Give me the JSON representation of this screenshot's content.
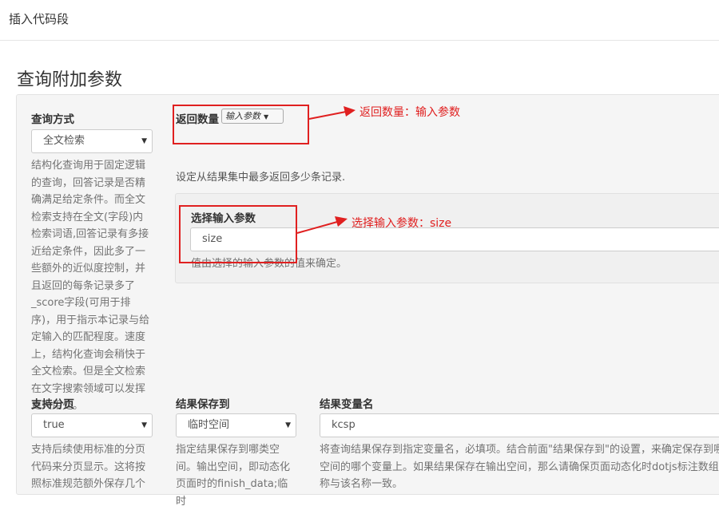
{
  "header": {
    "title": "插入代码段"
  },
  "section": {
    "title": "查询附加参数"
  },
  "query_method": {
    "label": "查询方式",
    "selected": "全文检索",
    "help": "结构化查询用于固定逻辑的查询，回答记录是否精确满足给定条件。而全文检索支持在全文(字段)内检索词语,回答记录有多接近给定条件，因此多了一些额外的近似度控制，并且返回的每条记录多了_score字段(可用于排序)，用于指示本记录与给定输入的匹配程度。速度上，结构化查询会稍快于全文检索。但是全文检索在文字搜索领域可以发挥更大用处。"
  },
  "return_count": {
    "label": "返回数量",
    "mode_selected": "输入参数",
    "help": "设定从结果集中最多返回多少条记录.",
    "param_label": "选择输入参数",
    "param_value": "size",
    "param_help": "值由选择的输入参数的值来确定。"
  },
  "paging": {
    "label": "支持分页",
    "selected": "true",
    "help": "支持后续使用标准的分页代码来分页显示。这将按照标准规范额外保存几个"
  },
  "save_to": {
    "label": "结果保存到",
    "selected": "临时空间",
    "help": "指定结果保存到哪类空间。输出空间，即动态化页面时的finish_data;临时"
  },
  "result_var": {
    "label": "结果变量名",
    "value": "kcsp",
    "help": "将查询结果保存到指定变量名，必填项。结合前面\"结果保存到\"的设置，来确定保存到哪类空间的哪个变量上。如果结果保存在输出空间，那么请确保页面动态化时dotjs标注数组名称与该名称一致。"
  },
  "annotations": {
    "return_count": "返回数量：输入参数",
    "select_param": "选择输入参数：size",
    "color": "#e02020"
  },
  "icons": {
    "caret": "caret-down-icon",
    "arrow": "arrow-right-icon"
  }
}
